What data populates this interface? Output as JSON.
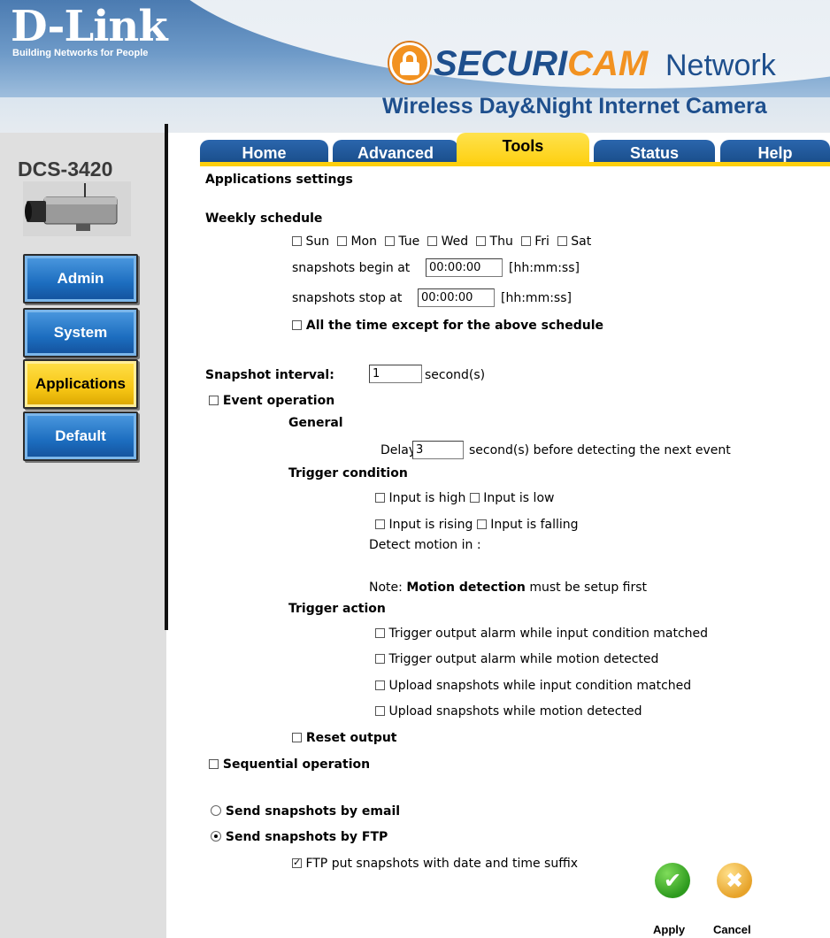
{
  "header": {
    "brand_logo": "D-Link",
    "brand_tagline": "Building Networks for People",
    "product_brand_securi": "SECURI",
    "product_brand_cam": "CAM",
    "product_brand_network": "Network",
    "product_line": "Wireless Day&Night Internet Camera"
  },
  "sidebar": {
    "model": "DCS-3420",
    "items": [
      {
        "label": "Admin",
        "active": false
      },
      {
        "label": "System",
        "active": false
      },
      {
        "label": "Applications",
        "active": true
      },
      {
        "label": "Default",
        "active": false
      }
    ]
  },
  "tabs": [
    {
      "label": "Home",
      "active": false
    },
    {
      "label": "Advanced",
      "active": false
    },
    {
      "label": "Tools",
      "active": true
    },
    {
      "label": "Status",
      "active": false
    },
    {
      "label": "Help",
      "active": false
    }
  ],
  "page": {
    "title": "Applications settings",
    "weekly_schedule_label": "Weekly schedule",
    "days": [
      {
        "label": "Sun",
        "checked": false
      },
      {
        "label": "Mon",
        "checked": false
      },
      {
        "label": "Tue",
        "checked": false
      },
      {
        "label": "Wed",
        "checked": false
      },
      {
        "label": "Thu",
        "checked": false
      },
      {
        "label": "Fri",
        "checked": false
      },
      {
        "label": "Sat",
        "checked": false
      }
    ],
    "begin_label": "snapshots begin at",
    "begin_value": "00:00:00",
    "stop_label": "snapshots stop at",
    "stop_value": "00:00:00",
    "time_format": "[hh:mm:ss]",
    "all_time_except_label": "All the time except for the above schedule",
    "snapshot_interval_label": "Snapshot interval:",
    "snapshot_interval_value": "1",
    "seconds_unit": "second(s)",
    "event_operation_label": "Event operation",
    "general_label": "General",
    "delay_label": "Delay",
    "delay_value": "3",
    "delay_suffix": "second(s) before detecting the next event",
    "trigger_condition_label": "Trigger condition",
    "input_high": "Input is high",
    "input_low": "Input is low",
    "input_rising": "Input is rising",
    "input_falling": "Input is falling",
    "detect_motion_label": "Detect motion in :",
    "note_prefix": "Note:",
    "note_bold": "Motion detection",
    "note_suffix": "must be setup first",
    "trigger_action_label": "Trigger action",
    "actions": [
      "Trigger output alarm while input condition matched",
      "Trigger output alarm while motion detected",
      "Upload snapshots while input condition matched",
      "Upload snapshots while motion detected"
    ],
    "reset_output_label": "Reset output",
    "sequential_label": "Sequential operation",
    "send_email_label": "Send snapshots by email",
    "send_ftp_label": "Send snapshots by FTP",
    "ftp_suffix_label": "FTP put snapshots with date and time suffix"
  },
  "buttons": {
    "apply": "Apply",
    "cancel": "Cancel"
  },
  "colors": {
    "header_blue": "#1e4f8d",
    "tab_blue": "#174a85",
    "tab_active_yellow": "#fdcf0d",
    "sidebar_button_blue": "#1c6dbf",
    "sidebar_button_active": "#f7c614",
    "securicam_orange": "#f29221"
  }
}
